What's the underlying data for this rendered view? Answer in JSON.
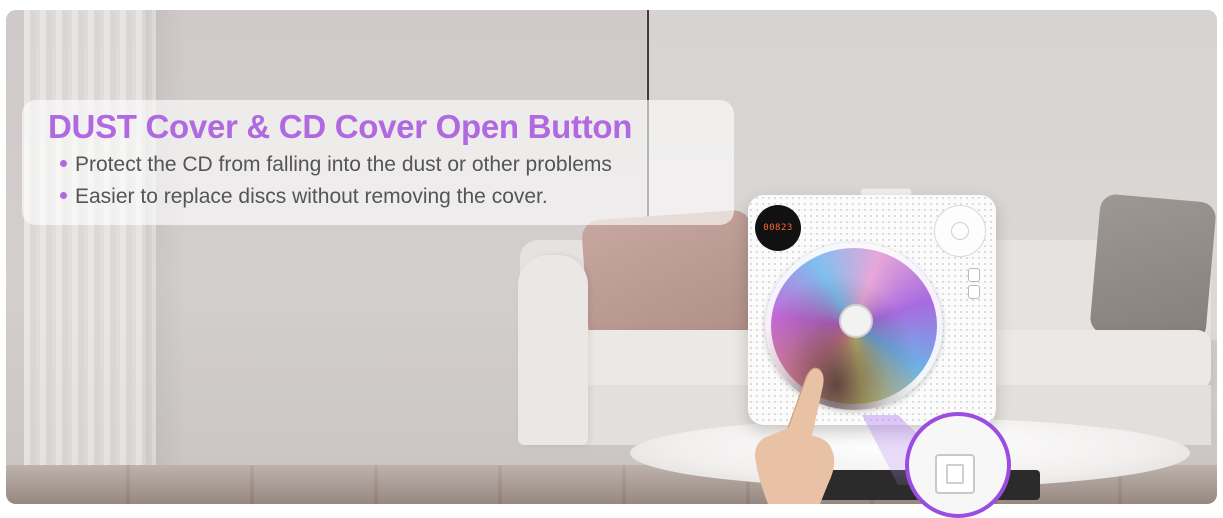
{
  "headline": "DUST Cover & CD Cover Open Button",
  "features": [
    "Protect the CD from falling into the dust or other problems",
    "Easier to replace discs without removing the cover."
  ],
  "player_display": "00823",
  "colors": {
    "accent": "#b069e0",
    "text": "#555555",
    "highlight_ring": "#9b4de0"
  },
  "icons": [
    "bullet-dot-icon",
    "cd-disc-icon",
    "open-button-icon"
  ]
}
